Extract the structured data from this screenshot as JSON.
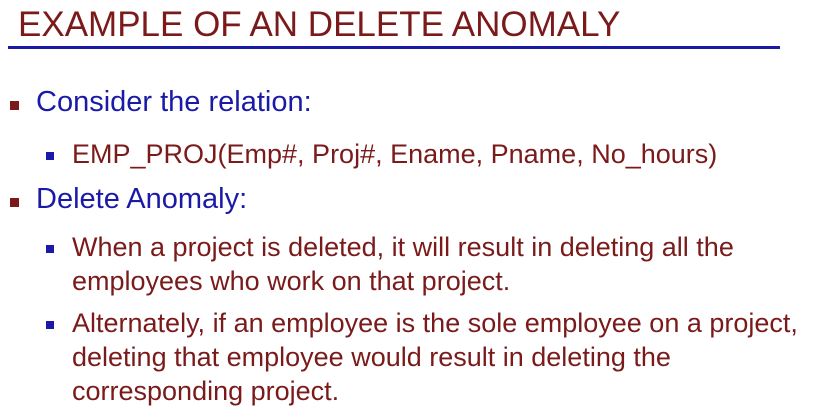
{
  "slide": {
    "title": "EXAMPLE OF AN DELETE ANOMALY",
    "items": [
      {
        "label": "Consider the relation:",
        "sub": [
          "EMP_PROJ(Emp#, Proj#, Ename, Pname, No_hours)"
        ]
      },
      {
        "label": "Delete Anomaly:",
        "sub": [
          "When a project is deleted, it will result in deleting all the employees who work on that project.",
          "Alternately, if an employee is the sole employee on a project, deleting that employee would result in deleting the corresponding project."
        ]
      }
    ]
  },
  "colors": {
    "title": "#7a1a1a",
    "rule": "#1a1aa6",
    "level1_text": "#1a1aa6",
    "level2_text": "#7a1a1a",
    "level1_bullet": "#7a1a1a",
    "level2_bullet": "#1a1aa6"
  }
}
